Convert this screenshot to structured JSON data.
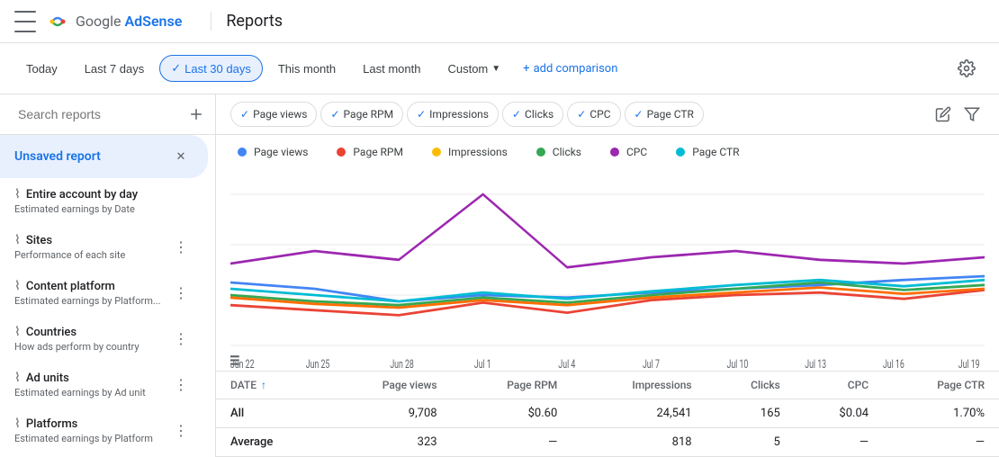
{
  "header": {
    "app_name": "Google AdSense",
    "page_title": "Reports"
  },
  "date_filters": {
    "buttons": [
      "Today",
      "Last 7 days",
      "Last 30 days",
      "This month",
      "Last month"
    ],
    "active": "Last 30 days",
    "custom_label": "Custom",
    "add_comparison": "+ add comparison"
  },
  "sidebar": {
    "search_placeholder": "Search reports",
    "items": [
      {
        "name": "Unsaved report",
        "desc": "",
        "active": true
      },
      {
        "name": "Entire account by day",
        "desc": "Estimated earnings by Date",
        "active": false
      },
      {
        "name": "Sites",
        "desc": "Performance of each site",
        "active": false
      },
      {
        "name": "Content platform",
        "desc": "Estimated earnings by Platform...",
        "active": false
      },
      {
        "name": "Countries",
        "desc": "How ads perform by country",
        "active": false
      },
      {
        "name": "Ad units",
        "desc": "Estimated earnings by Ad unit",
        "active": false
      },
      {
        "name": "Platforms",
        "desc": "Estimated earnings by Platform",
        "active": false
      }
    ]
  },
  "metric_tabs": [
    {
      "label": "Page views",
      "checked": true
    },
    {
      "label": "Page RPM",
      "checked": true
    },
    {
      "label": "Impressions",
      "checked": true
    },
    {
      "label": "Clicks",
      "checked": true
    },
    {
      "label": "CPC",
      "checked": true
    },
    {
      "label": "Page CTR",
      "checked": true
    }
  ],
  "legend": [
    {
      "label": "Page views",
      "color": "#4285f4"
    },
    {
      "label": "Page RPM",
      "color": "#ea4335"
    },
    {
      "label": "Impressions",
      "color": "#fbbc04"
    },
    {
      "label": "Clicks",
      "color": "#34a853"
    },
    {
      "label": "CPC",
      "color": "#9c27b0"
    },
    {
      "label": "Page CTR",
      "color": "#00bcd4"
    }
  ],
  "chart": {
    "x_labels": [
      "Jun 22",
      "Jun 25",
      "Jun 28",
      "Jul 1",
      "Jul 4",
      "Jul 7",
      "Jul 10",
      "Jul 13",
      "Jul 16",
      "Jul 19"
    ],
    "series": {
      "page_views": [
        60,
        55,
        45,
        50,
        48,
        52,
        55,
        58,
        62,
        65
      ],
      "page_rpm": [
        40,
        38,
        35,
        42,
        36,
        44,
        48,
        50,
        45,
        52
      ],
      "impressions": [
        70,
        90,
        75,
        120,
        65,
        72,
        80,
        85,
        75,
        80
      ],
      "clicks": [
        50,
        45,
        42,
        48,
        44,
        50,
        55,
        60,
        52,
        58
      ],
      "cpc": [
        45,
        42,
        38,
        44,
        40,
        46,
        50,
        54,
        48,
        55
      ],
      "page_ctr": [
        55,
        60,
        55,
        65,
        58,
        62,
        66,
        68,
        60,
        70
      ]
    }
  },
  "table": {
    "columns": [
      "DATE",
      "Page views",
      "Page RPM",
      "Impressions",
      "Clicks",
      "CPC",
      "Page CTR"
    ],
    "rows": [
      {
        "date": "All",
        "page_views": "9,708",
        "page_rpm": "$0.60",
        "impressions": "24,541",
        "clicks": "165",
        "cpc": "$0.04",
        "page_ctr": "1.70%"
      },
      {
        "date": "Average",
        "page_views": "323",
        "page_rpm": "—",
        "impressions": "818",
        "clicks": "5",
        "cpc": "—",
        "page_ctr": "—"
      }
    ]
  }
}
